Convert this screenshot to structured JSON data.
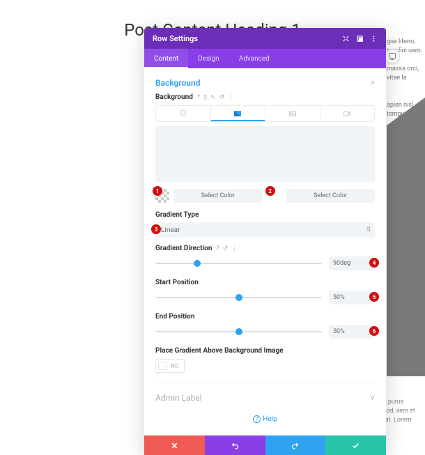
{
  "page": {
    "heading": "Post Content Heading 1"
  },
  "bg_text": {
    "t1": "gue libero, nec fini\nuam.",
    "t2": "massa orci, vitae la",
    "t3": "apien nisl, tempus\nrpis."
  },
  "modal": {
    "title": "Row Settings",
    "tabs": {
      "content": "Content",
      "design": "Design",
      "advanced": "Advanced"
    }
  },
  "section": {
    "title": "Background",
    "field_label": "Background",
    "select_color": "Select Color",
    "gradient_type_label": "Gradient Type",
    "gradient_type_value": "Linear",
    "gradient_direction_label": "Gradient Direction",
    "gradient_direction_value": "90deg",
    "start_position_label": "Start Position",
    "start_position_value": "50%",
    "end_position_label": "End Position",
    "end_position_value": "50%",
    "place_above_label": "Place Gradient Above Background Image",
    "toggle_no": "NO"
  },
  "badges": {
    "b1": "1",
    "b2": "2",
    "b3": "3",
    "b4": "4",
    "b5": "5",
    "b6": "6"
  },
  "admin_label": "Admin Label",
  "help": "Help",
  "bottom_text": "auctor leo. Morbi eu odio tempus et. Curabitur at tempor risus, id mattis felis. Praesent purus ligula, ultricies vel porta ac, elemen condimentum est ut, vehicula sapien. Donec euismod, sem et elementum finibus, lacus mauris pulvinar libero, nec fa morbi eget felis porttitor volutpat. Lorem ipsum dolor sit amet, consectetur adipiscing elit."
}
